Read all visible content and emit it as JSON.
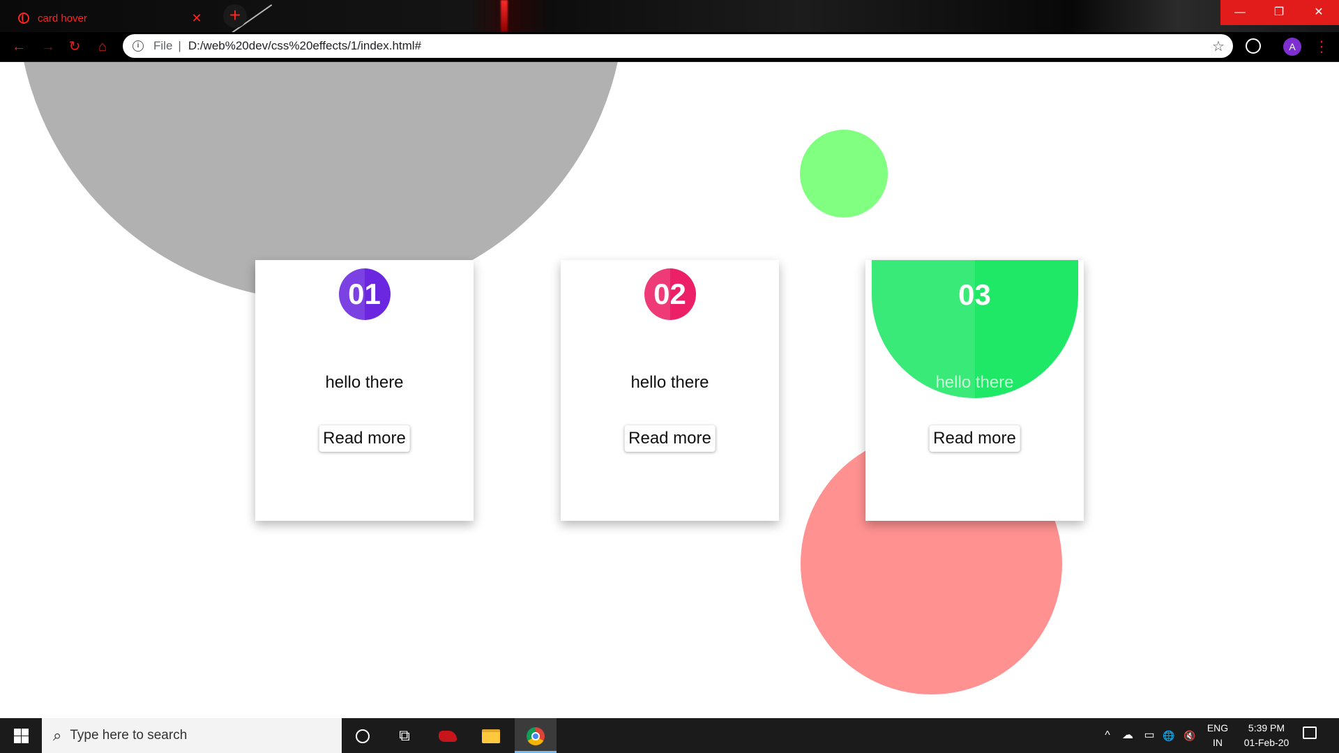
{
  "browser": {
    "tab": {
      "title": "card hover",
      "close": "✕"
    },
    "new_tab": "+",
    "window_controls": {
      "minimize": "—",
      "restore": "❐",
      "close": "✕"
    },
    "nav": {
      "back": "←",
      "forward": "→",
      "reload": "↻",
      "home": "⌂"
    },
    "address_bar": {
      "info": "i",
      "scheme": "File",
      "separator": "|",
      "url": "D:/web%20dev/css%20effects/1/index.html#",
      "bookmark": "☆"
    },
    "profile_initial": "A",
    "menu": "⋮",
    "accent_color": "#e0201b"
  },
  "cards": [
    {
      "number": "01",
      "text": "hello there",
      "button": "Read more",
      "color": "#6a27df"
    },
    {
      "number": "02",
      "text": "hello there",
      "button": "Read more",
      "color": "#ec2066"
    },
    {
      "number": "03",
      "text": "hello there",
      "button": "Read more",
      "color": "#1fe866",
      "state": "hovered"
    }
  ],
  "background_circles": [
    {
      "name": "gray",
      "color": "#b1b1b1"
    },
    {
      "name": "green",
      "color": "#80ff80"
    },
    {
      "name": "pink",
      "color": "#ff9191"
    }
  ],
  "taskbar": {
    "search_placeholder": "Type here to search",
    "search_icon": "⌕",
    "task_view": "⧉",
    "tray": {
      "chevron": "^",
      "battery": "▭",
      "globe": "🌐",
      "volume": "🔇",
      "network": "☁"
    },
    "language": {
      "line1": "ENG",
      "line2": "IN"
    },
    "time": "5:39 PM",
    "date": "01-Feb-20",
    "apps": [
      "cortana",
      "task-view",
      "red-app",
      "file-explorer",
      "chrome"
    ],
    "active_app": "chrome"
  }
}
